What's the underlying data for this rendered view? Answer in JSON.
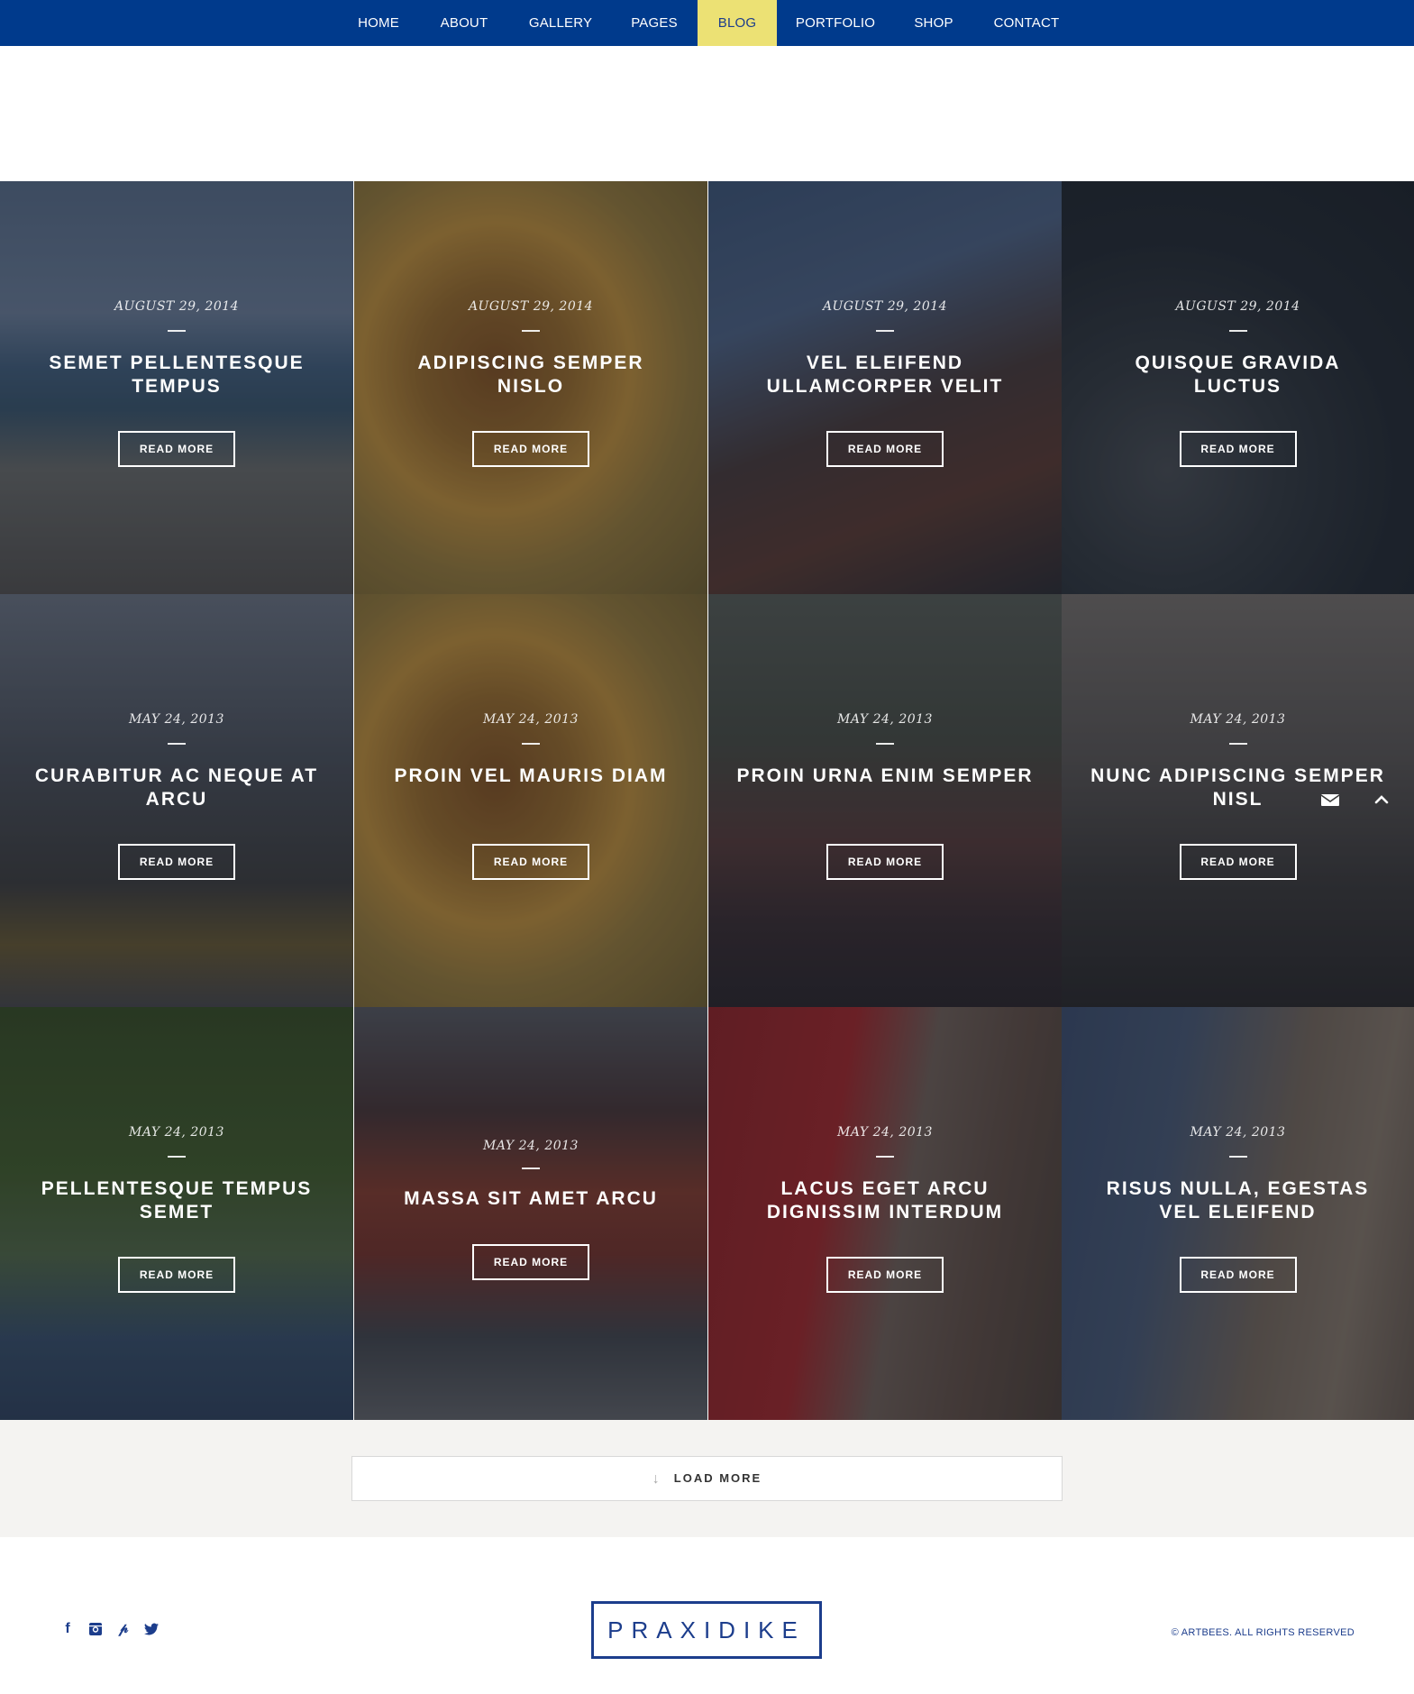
{
  "nav": {
    "items": [
      {
        "label": "HOME",
        "active": false
      },
      {
        "label": "ABOUT",
        "active": false
      },
      {
        "label": "GALLERY",
        "active": false
      },
      {
        "label": "PAGES",
        "active": false
      },
      {
        "label": "BLOG",
        "active": true
      },
      {
        "label": "PORTFOLIO",
        "active": false
      },
      {
        "label": "SHOP",
        "active": false
      },
      {
        "label": "CONTACT",
        "active": false
      }
    ],
    "bar_color": "#003a8c",
    "active_color": "#ece174"
  },
  "posts": [
    {
      "date": "AUGUST 29, 2014",
      "title": "SEMET PELLENTESQUE TEMPUS",
      "button": "READ MORE",
      "image": "beach-shore"
    },
    {
      "date": "AUGUST 29, 2014",
      "title": "ADIPISCING SEMPER NISLO",
      "button": "READ MORE",
      "image": "woman-sunset-field"
    },
    {
      "date": "AUGUST 29, 2014",
      "title": "VEL ELEIFEND ULLAMCORPER VELIT",
      "button": "READ MORE",
      "image": "vintage-car-taillight"
    },
    {
      "date": "AUGUST 29, 2014",
      "title": "QUISQUE GRAVIDA LUCTUS",
      "button": "READ MORE",
      "image": "typewriter-keys"
    },
    {
      "date": "MAY 24, 2013",
      "title": "CURABITUR AC NEQUE AT ARCU",
      "button": "READ MORE",
      "image": "city-taxis"
    },
    {
      "date": "MAY 24, 2013",
      "title": "PROIN VEL MAURIS DIAM",
      "button": "READ MORE",
      "image": "woman-sunset-field"
    },
    {
      "date": "MAY 24, 2013",
      "title": "PROIN URNA ENIM SEMPER",
      "button": "READ MORE",
      "image": "acton-station"
    },
    {
      "date": "MAY 24, 2013",
      "title": "NUNC ADIPISCING SEMPER NISL",
      "button": "READ MORE",
      "image": "street-bicycle"
    },
    {
      "date": "MAY 24, 2013",
      "title": "PELLENTESQUE TEMPUS SEMET",
      "button": "READ MORE",
      "image": "sneakers-grass"
    },
    {
      "date": "MAY 24, 2013",
      "title": "MASSA SIT AMET ARCU",
      "button": "READ MORE",
      "image": "red-truck"
    },
    {
      "date": "MAY 24, 2013",
      "title": "LACUS EGET ARCU DIGNISSIM INTERDUM",
      "button": "READ MORE",
      "image": "red-backpack-headphones"
    },
    {
      "date": "MAY 24, 2013",
      "title": "RISUS NULLA, EGESTAS VEL ELEIFEND",
      "button": "READ MORE",
      "image": "sunglasses-headphones"
    }
  ],
  "load_more": {
    "label": "LOAD MORE",
    "icon": "arrow-down-icon"
  },
  "footer": {
    "social": [
      "facebook-icon",
      "instagram-icon",
      "pinterest-icon",
      "twitter-icon"
    ],
    "logo": "PRAXIDIKE",
    "copyright": "© ARTBEES. ALL RIGHTS RESERVED"
  },
  "floating": {
    "mail_icon": "envelope-icon",
    "top_icon": "chevron-up-icon"
  }
}
